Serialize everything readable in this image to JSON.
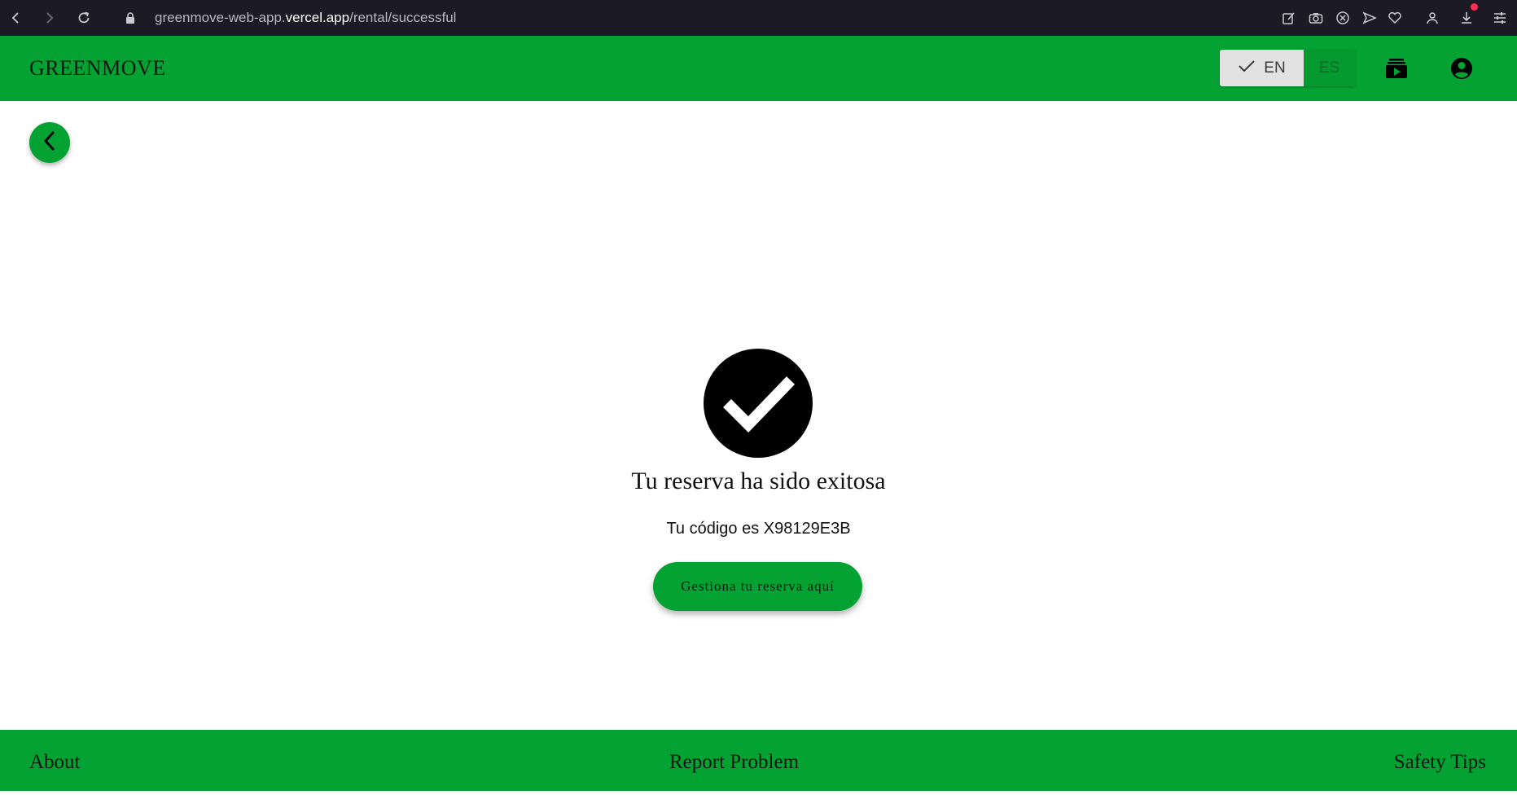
{
  "browser": {
    "url_prefix": "greenmove-web-app.",
    "url_host": "vercel.app",
    "url_path": "/rental/successful",
    "icons": [
      "back-arrow-icon",
      "forward-arrow-icon",
      "reload-icon",
      "lock-icon",
      "edit-icon",
      "camera-icon",
      "shield-x-icon",
      "send-icon",
      "heart-icon",
      "user-icon",
      "download-icon",
      "settings-sliders-icon"
    ]
  },
  "header": {
    "brand": "GREENMOVE",
    "lang_en": "EN",
    "lang_es": "ES",
    "selected_lang": "EN",
    "icons": [
      "check-icon",
      "reservations-icon",
      "account-circle-icon"
    ]
  },
  "main": {
    "title": "Tu reserva ha sido exitosa",
    "code_text": "Tu código es X98129E3B",
    "manage_button": "Gestiona tu reserva aquí"
  },
  "footer": {
    "about": "About",
    "report": "Report Problem",
    "safety": "Safety Tips"
  },
  "colors": {
    "primary_green": "#04a232",
    "browser_bar": "#1b1a25"
  }
}
